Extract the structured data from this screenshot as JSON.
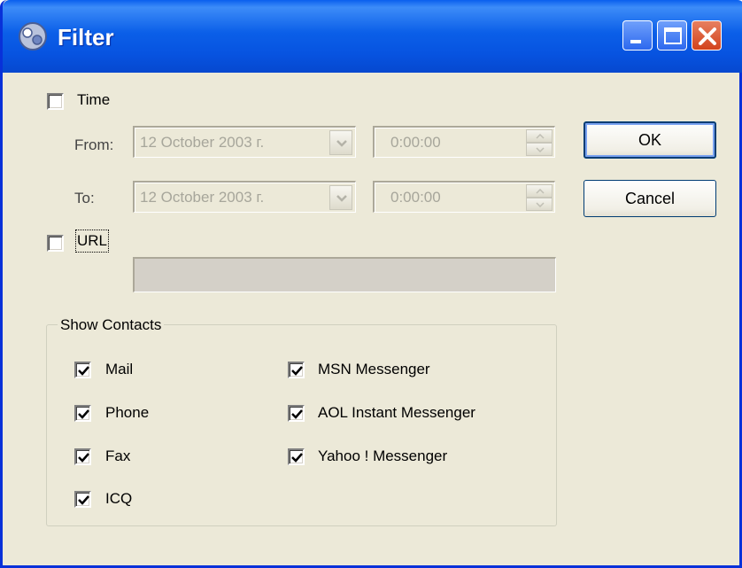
{
  "window": {
    "title": "Filter",
    "controls": [
      "minimize-icon",
      "maximize-icon",
      "close-icon"
    ]
  },
  "time": {
    "label": "Time",
    "checked": false,
    "from_label": "From:",
    "to_label": "To:",
    "from_date": "12  October  2003 г.",
    "from_time": "0:00:00",
    "to_date": "12  October  2003 г.",
    "to_time": "0:00:00"
  },
  "url": {
    "label": "URL",
    "checked": false,
    "value": ""
  },
  "buttons": {
    "ok": "OK",
    "cancel": "Cancel"
  },
  "show_contacts": {
    "title": "Show Contacts",
    "left": [
      {
        "label": "Mail",
        "checked": true
      },
      {
        "label": "Phone",
        "checked": true
      },
      {
        "label": "Fax",
        "checked": true
      },
      {
        "label": "ICQ",
        "checked": true
      }
    ],
    "right": [
      {
        "label": "MSN Messenger",
        "checked": true
      },
      {
        "label": "AOL Instant Messenger",
        "checked": true
      },
      {
        "label": "Yahoo ! Messenger",
        "checked": true
      }
    ]
  },
  "colors": {
    "titlebar": "#0b5fe8",
    "dialog_bg": "#ece9d8",
    "disabled_text": "#a7a69b",
    "check_mark": "#21a121"
  }
}
